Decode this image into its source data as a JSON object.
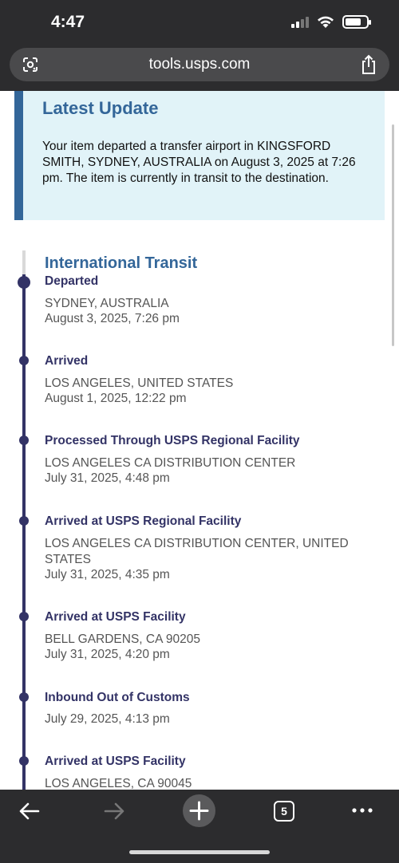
{
  "status_bar": {
    "time": "4:47"
  },
  "browser": {
    "url": "tools.usps.com",
    "tab_count": "5"
  },
  "latest_update": {
    "title": "Latest Update",
    "text": "Your item departed a transfer airport in KINGSFORD SMITH, SYDNEY, AUSTRALIA on August 3, 2025 at 7:26 pm. The item is currently in transit to the destination."
  },
  "timeline": {
    "section_title": "International Transit",
    "events": [
      {
        "status": "Departed",
        "location": "SYDNEY, AUSTRALIA",
        "date": "August 3, 2025, 7:26 pm"
      },
      {
        "status": "Arrived",
        "location": "LOS ANGELES, UNITED STATES",
        "date": "August 1, 2025, 12:22 pm"
      },
      {
        "status": "Processed Through USPS Regional Facility",
        "location": "LOS ANGELES CA DISTRIBUTION CENTER",
        "date": "July 31, 2025, 4:48 pm"
      },
      {
        "status": "Arrived at USPS Regional Facility",
        "location": "LOS ANGELES CA DISTRIBUTION CENTER, UNITED STATES",
        "date": "July 31, 2025, 4:35 pm"
      },
      {
        "status": "Arrived at USPS Facility",
        "location": "BELL GARDENS, CA 90205",
        "date": "July 31, 2025, 4:20 pm"
      },
      {
        "status": "Inbound Out of Customs",
        "location": "",
        "date": "July 29, 2025, 4:13 pm"
      },
      {
        "status": "Arrived at USPS Facility",
        "location": "LOS ANGELES, CA 90045",
        "date": ""
      }
    ]
  },
  "colors": {
    "primary": "#336699",
    "event_text": "#333366",
    "card_bg": "#e1f3f8",
    "chrome": "#2c2c2e"
  },
  "icons": [
    "lens-icon",
    "share-icon",
    "back-arrow-icon",
    "forward-arrow-icon",
    "plus-icon",
    "more-icon",
    "wifi-icon",
    "signal-icon",
    "battery-icon"
  ]
}
